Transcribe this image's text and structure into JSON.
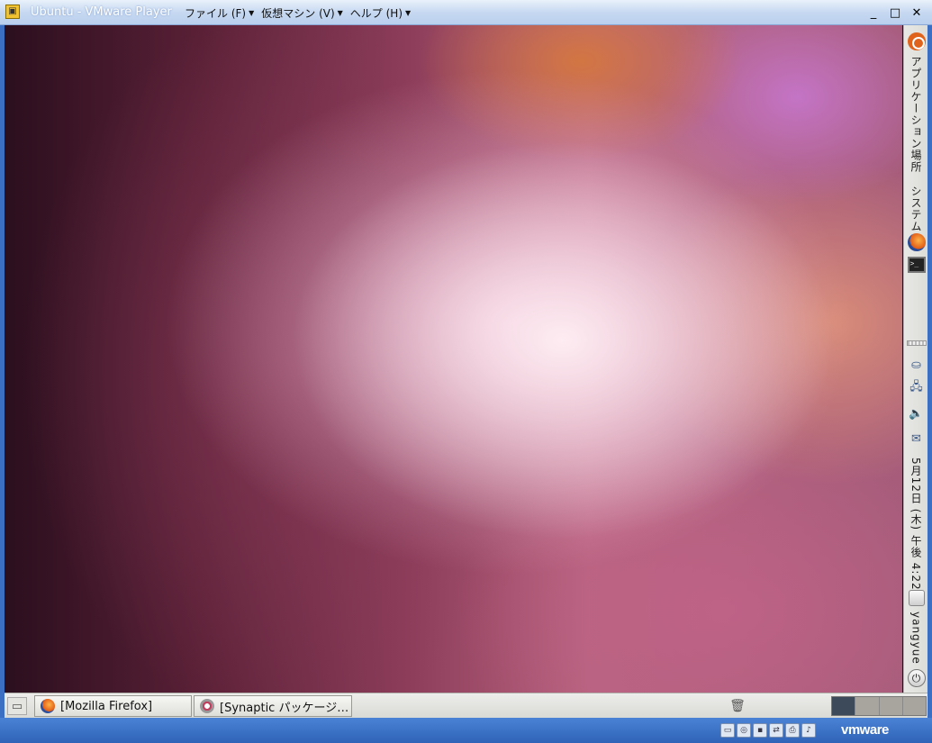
{
  "window": {
    "title": "Ubuntu - VMware Player",
    "menus": [
      {
        "label": "ファイル (F)"
      },
      {
        "label": "仮想マシン (V)"
      },
      {
        "label": "ヘルプ (H)"
      }
    ],
    "controls": {
      "minimize": "_",
      "maximize": "□",
      "close": "✕"
    }
  },
  "side_panel": {
    "applications": "アプリケーション",
    "places": "場所",
    "system": "システム",
    "clock": "5月12日 (木) 午後 4:22",
    "user": "yangyue",
    "icons": [
      "ubuntu-logo-icon",
      "firefox-icon",
      "terminal-icon",
      "network-icon",
      "display-icon",
      "volume-icon",
      "mail-icon",
      "power-icon"
    ]
  },
  "taskbar": {
    "tasks": [
      {
        "label": "[Mozilla Firefox]",
        "icon": "firefox-icon"
      },
      {
        "label": "[Synaptic パッケージ…",
        "icon": "synaptic-icon"
      }
    ],
    "workspaces": 4,
    "active_workspace": 1
  },
  "statusbar": {
    "brand": "vmware",
    "device_icons": [
      "hard-disk-icon",
      "cdrom-icon",
      "floppy-icon",
      "network-adapter-icon",
      "printer-icon",
      "sound-icon"
    ]
  },
  "colors": {
    "vmware_blue": "#2f63b8",
    "panel_grey": "#dcdcd8",
    "ubuntu_orange": "#e0631b"
  }
}
